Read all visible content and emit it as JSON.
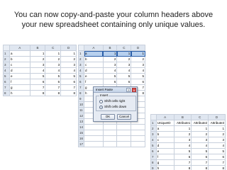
{
  "headline": "You can now copy-and-paste your column headers above your new spreadsheet containing only unique values.",
  "sheet1": {
    "columns": [
      "A",
      "B",
      "C",
      "D"
    ],
    "rows": [
      {
        "n": "1",
        "cells": [
          "a",
          "1",
          "1",
          "1"
        ]
      },
      {
        "n": "2",
        "cells": [
          "b",
          "2",
          "2",
          "2"
        ]
      },
      {
        "n": "3",
        "cells": [
          "c",
          "3",
          "3",
          "3"
        ]
      },
      {
        "n": "4",
        "cells": [
          "d",
          "4",
          "4",
          "4"
        ]
      },
      {
        "n": "5",
        "cells": [
          "e",
          "5",
          "5",
          "5"
        ]
      },
      {
        "n": "6",
        "cells": [
          "f",
          "6",
          "6",
          "6"
        ]
      },
      {
        "n": "7",
        "cells": [
          "g",
          "7",
          "7",
          "7"
        ]
      },
      {
        "n": "8",
        "cells": [
          "h",
          "8",
          "8",
          "8"
        ]
      }
    ]
  },
  "sheet2": {
    "columns": [
      "A",
      "B",
      "C",
      "D"
    ],
    "rows": [
      {
        "n": "1",
        "cells": [
          "a",
          "1",
          "1",
          "1"
        ]
      },
      {
        "n": "2",
        "cells": [
          "b",
          "2",
          "2",
          "2"
        ]
      },
      {
        "n": "3",
        "cells": [
          "c",
          "3",
          "3",
          "3"
        ]
      },
      {
        "n": "4",
        "cells": [
          "d",
          "4",
          "4",
          "4"
        ]
      },
      {
        "n": "5",
        "cells": [
          "e",
          "5",
          "5",
          "5"
        ]
      },
      {
        "n": "6",
        "cells": [
          "f",
          "6",
          "6",
          "6"
        ]
      },
      {
        "n": "7",
        "cells": [
          "g",
          "7",
          "7",
          "7"
        ]
      },
      {
        "n": "8",
        "cells": [
          "h",
          "8",
          "8",
          "8"
        ]
      },
      {
        "n": "9",
        "cells": [
          "",
          "",
          "",
          ""
        ]
      },
      {
        "n": "10",
        "cells": [
          "",
          "",
          "",
          ""
        ]
      },
      {
        "n": "11",
        "cells": [
          "",
          "",
          "",
          ""
        ]
      },
      {
        "n": "12",
        "cells": [
          "",
          "",
          "",
          ""
        ]
      },
      {
        "n": "13",
        "cells": [
          "",
          "",
          "",
          ""
        ]
      },
      {
        "n": "14",
        "cells": [
          "",
          "",
          "",
          ""
        ]
      },
      {
        "n": "15",
        "cells": [
          "",
          "",
          "",
          ""
        ]
      },
      {
        "n": "16",
        "cells": [
          "",
          "",
          "",
          ""
        ]
      },
      {
        "n": "17",
        "cells": [
          "",
          "",
          "",
          ""
        ]
      }
    ]
  },
  "dialog": {
    "title": "Insert Paste",
    "qmark": "?",
    "close": "x",
    "group_label": "Insert",
    "option_right": "Shift cells right",
    "option_down": "Shift cells down",
    "ok": "OK",
    "cancel": "Cancel"
  },
  "sheet3": {
    "columns": [
      "A",
      "B",
      "C",
      "D"
    ],
    "rows": [
      {
        "n": "1",
        "cells": [
          "UniqueID",
          "Attribute1",
          "Attribute2",
          "Attribute3"
        ]
      },
      {
        "n": "2",
        "cells": [
          "a",
          "1",
          "1",
          "1"
        ]
      },
      {
        "n": "3",
        "cells": [
          "b",
          "2",
          "2",
          "2"
        ]
      },
      {
        "n": "4",
        "cells": [
          "c",
          "3",
          "3",
          "3"
        ]
      },
      {
        "n": "5",
        "cells": [
          "d",
          "4",
          "4",
          "4"
        ]
      },
      {
        "n": "6",
        "cells": [
          "e",
          "5",
          "5",
          "5"
        ]
      },
      {
        "n": "7",
        "cells": [
          "f",
          "6",
          "6",
          "6"
        ]
      },
      {
        "n": "8",
        "cells": [
          "g",
          "7",
          "7",
          "7"
        ]
      },
      {
        "n": "9",
        "cells": [
          "h",
          "8",
          "8",
          "8"
        ]
      }
    ]
  }
}
